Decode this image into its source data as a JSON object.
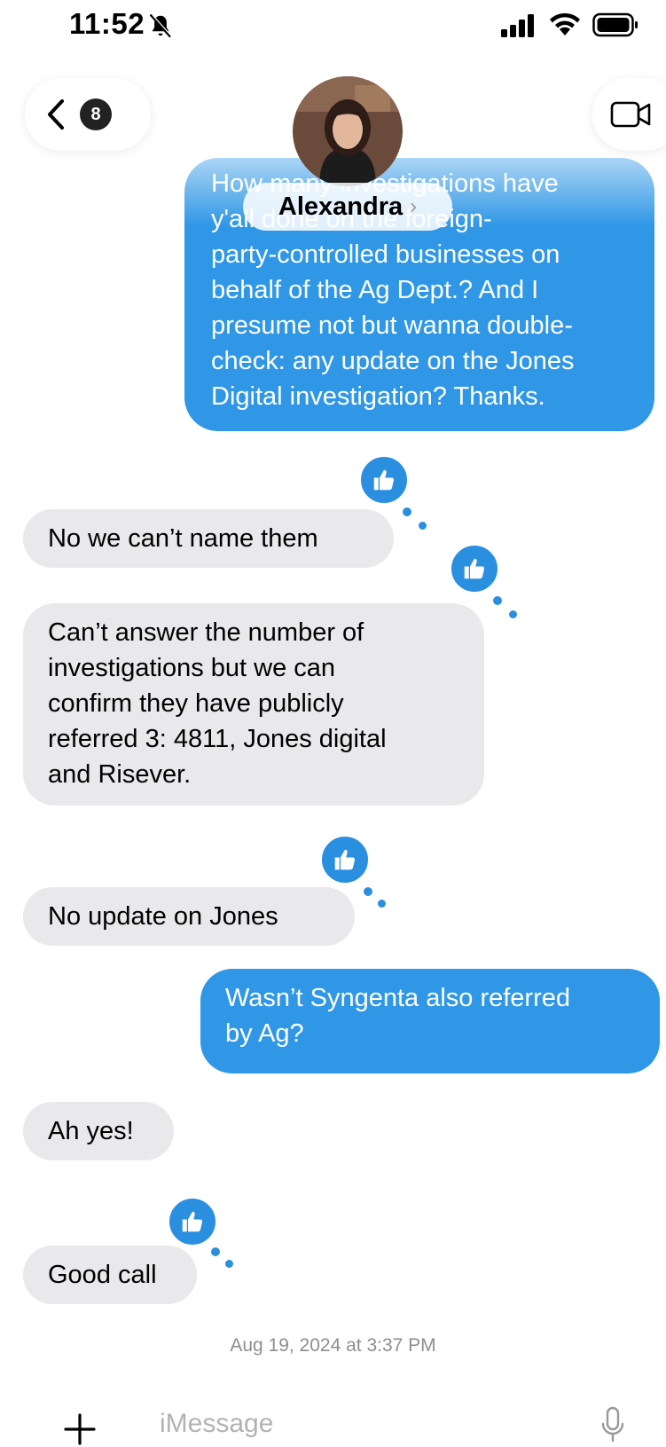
{
  "status_bar": {
    "time": "11:52"
  },
  "header": {
    "back_badge_count": "8",
    "contact_name": "Alexandra"
  },
  "messages": [
    {
      "direction": "out",
      "text": "How many investigations have\ny'all done on the foreign-\nparty-controlled businesses on\nbehalf of the Ag Dept.? And I\npresume not but wanna double-\ncheck: any update on the Jones\nDigital investigation? Thanks."
    },
    {
      "direction": "in",
      "text": "No we can’t name them",
      "tapback": "thumbs-up"
    },
    {
      "direction": "in",
      "text": "Can’t answer the number of\ninvestigations but we can\nconfirm they have publicly\nreferred 3: 4811, Jones digital\nand Risever.",
      "tapback": "thumbs-up"
    },
    {
      "direction": "in",
      "text": "No update on Jones",
      "tapback": "thumbs-up"
    },
    {
      "direction": "out",
      "text": "Wasn’t Syngenta also referred\nby Ag?"
    },
    {
      "direction": "in",
      "text": "Ah yes!"
    },
    {
      "direction": "in",
      "text": "Good call",
      "tapback": "thumbs-up"
    }
  ],
  "timestamp": {
    "date": "Aug 19, 2024",
    "at": "at",
    "time": "3:37 PM"
  },
  "compose": {
    "placeholder": "iMessage"
  },
  "colors": {
    "outgoing_bubble": "#2f97e6",
    "incoming_bubble": "#e9e9eb",
    "tapback": "#2b8fe0"
  }
}
